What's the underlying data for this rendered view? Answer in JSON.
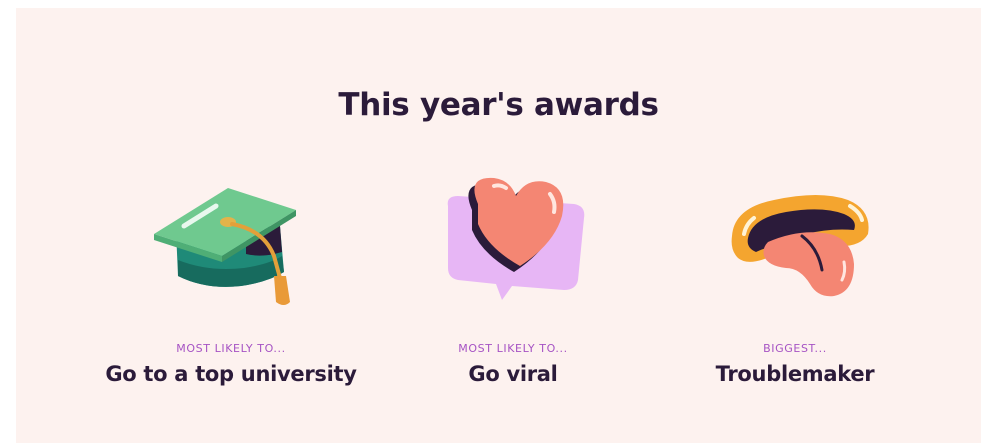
{
  "section": {
    "title": "This year's awards"
  },
  "awards": [
    {
      "kicker": "MOST LIKELY TO...",
      "name": "Go to a top university",
      "icon": "graduation-cap-icon"
    },
    {
      "kicker": "MOST LIKELY TO...",
      "name": "Go viral",
      "icon": "heart-speech-bubble-icon"
    },
    {
      "kicker": "BIGGEST...",
      "name": "Troublemaker",
      "icon": "tongue-out-mouth-icon"
    }
  ],
  "colors": {
    "background": "#fdf2ef",
    "heading": "#2b1b3a",
    "kicker": "#a653c4"
  }
}
